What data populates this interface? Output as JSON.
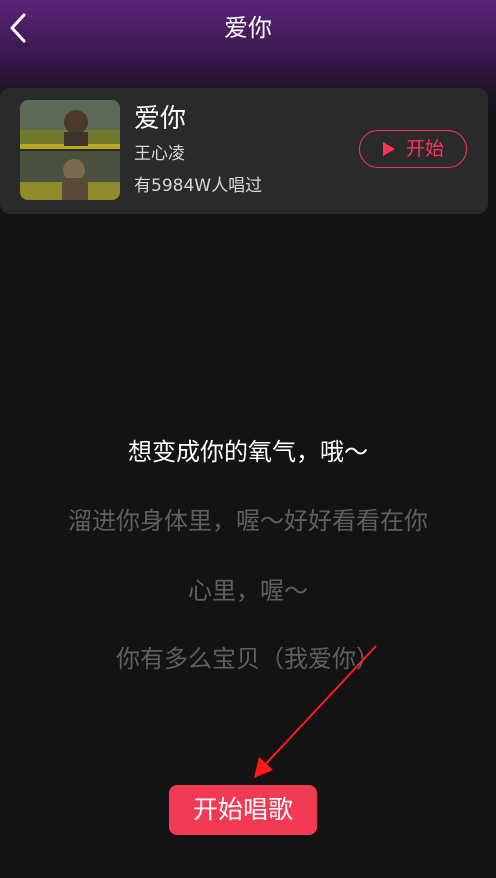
{
  "header": {
    "title": "爱你",
    "back_icon": "chevron-left-icon"
  },
  "song": {
    "title": "爱你",
    "artist": "王心凌",
    "sung_count": "有5984W人唱过",
    "start_label": "开始",
    "play_icon": "play-icon"
  },
  "lyrics": {
    "current": "想变成你的氧气，哦～",
    "next": [
      "溜进你身体里，喔～好好看看在你",
      "心里，喔～",
      "你有多么宝贝（我爱你）"
    ]
  },
  "sing_button": {
    "label": "开始唱歌"
  },
  "colors": {
    "accent": "#ff3355",
    "sing_button": "#f23a55",
    "header_top": "#5c2378",
    "background": "#131313",
    "card": "#2a2a2a",
    "annotation_arrow": "#ff1a1a"
  }
}
